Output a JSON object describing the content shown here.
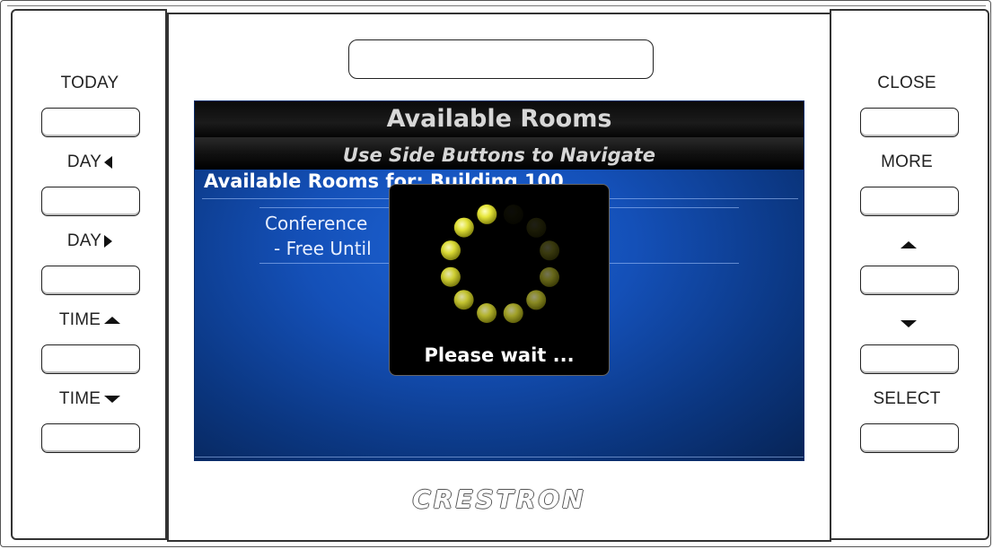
{
  "left_panel": {
    "buttons": [
      {
        "label": "TODAY",
        "icon": ""
      },
      {
        "label": "DAY",
        "icon": "triangle-left-icon"
      },
      {
        "label": "DAY",
        "icon": "triangle-right-icon"
      },
      {
        "label": "TIME",
        "icon": "triangle-up-icon"
      },
      {
        "label": "TIME",
        "icon": "triangle-down-icon"
      }
    ]
  },
  "right_panel": {
    "buttons": [
      {
        "label": "CLOSE",
        "icon": ""
      },
      {
        "label": "MORE",
        "icon": ""
      },
      {
        "label": "",
        "icon": "triangle-up-icon"
      },
      {
        "label": "",
        "icon": "triangle-down-icon"
      },
      {
        "label": "SELECT",
        "icon": ""
      }
    ]
  },
  "screen": {
    "title": "Available Rooms",
    "subtitle": "Use Side Buttons to Navigate",
    "list_title": "Available Rooms for: Building 100",
    "room": {
      "name": "Conference",
      "status": "- Free Until"
    },
    "colors": {
      "background": "#1450b8",
      "bar": "#0a0a0a",
      "spinner": "#e6e63a"
    }
  },
  "wait_dialog": {
    "message": "Please wait ..."
  },
  "brand": "CRESTRON"
}
